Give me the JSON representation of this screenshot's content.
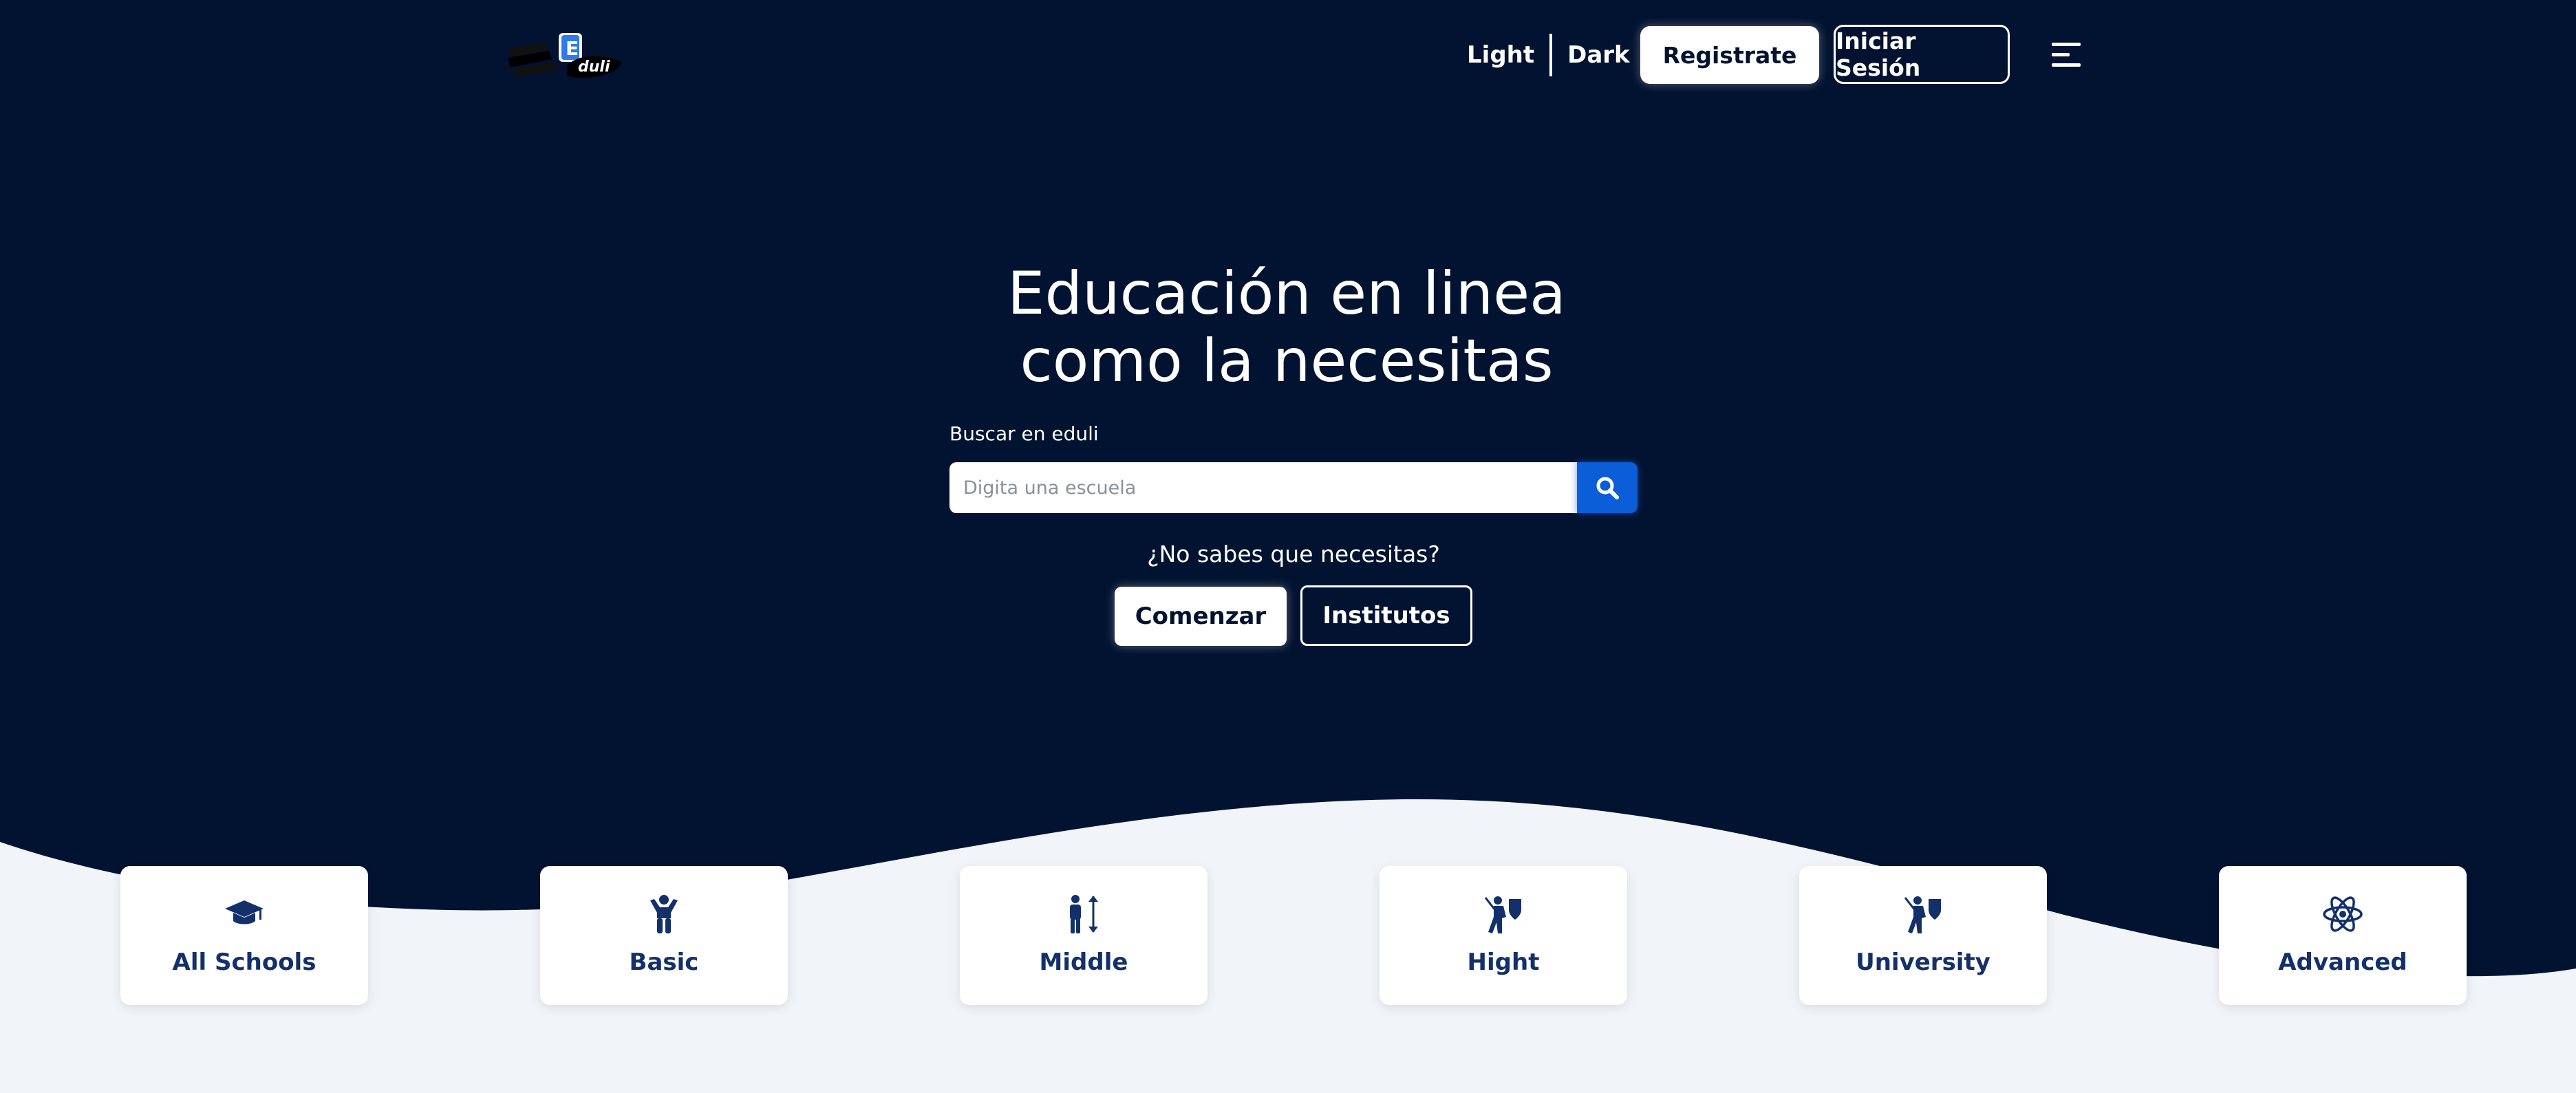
{
  "header": {
    "logo_alt": "Eduli",
    "theme_light": "Light",
    "theme_dark": "Dark",
    "register_label": "Registrate",
    "login_label": "Iniciar Sesión"
  },
  "hero": {
    "title_line1": "Educación en linea",
    "title_line2": "como la necesitas",
    "search_label": "Buscar en eduli",
    "search_placeholder": "Digita una escuela",
    "search_value": "",
    "help_text": "¿No sabes que necesitas?",
    "start_label": "Comenzar",
    "institutes_label": "Institutos"
  },
  "categories": [
    {
      "label": "All Schools",
      "icon": "graduation-cap-icon"
    },
    {
      "label": "Basic",
      "icon": "child-icon"
    },
    {
      "label": "Middle",
      "icon": "person-height-icon"
    },
    {
      "label": "Hight",
      "icon": "knight-shield-icon"
    },
    {
      "label": "University",
      "icon": "knight-shield-icon"
    },
    {
      "label": "Advanced",
      "icon": "atom-icon"
    }
  ],
  "colors": {
    "hero_bg": "#021331",
    "page_bg": "#f1f4f8",
    "accent_blue": "#0b5ed7",
    "card_text": "#13306b"
  }
}
